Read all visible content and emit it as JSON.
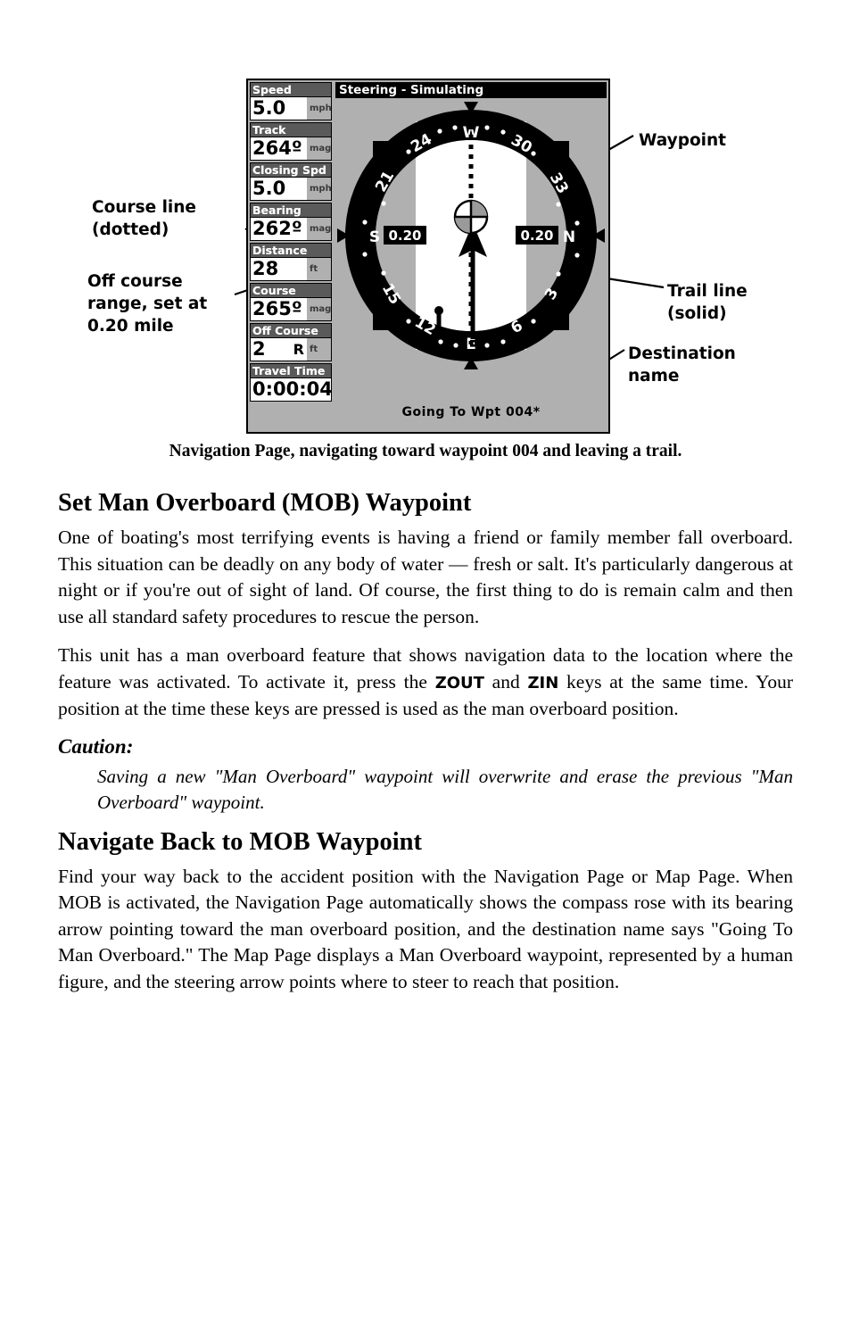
{
  "figure": {
    "panel_title": "Steering - Simulating",
    "destination_name": "Going To Wpt 004*",
    "data_fields": [
      {
        "label": "Speed",
        "value": "5.0",
        "unit": "mph"
      },
      {
        "label": "Track",
        "value": "264º",
        "unit": "mag"
      },
      {
        "label": "Closing Spd",
        "value": "5.0",
        "unit": "mph"
      },
      {
        "label": "Bearing",
        "value": "262º",
        "unit": "mag"
      },
      {
        "label": "Distance",
        "value": "28",
        "unit": "ft"
      },
      {
        "label": "Course",
        "value": "265º",
        "unit": "mag"
      },
      {
        "label": "Off Course",
        "value": "2",
        "side": "R",
        "unit": "ft"
      },
      {
        "label": "Travel Time",
        "value": "0:00:04",
        "unit": ""
      }
    ],
    "compass": {
      "cardinals": [
        "W",
        "N",
        "E",
        "S"
      ],
      "numeric_ticks": [
        "24",
        "21",
        "30",
        "33",
        "15",
        "3",
        "12",
        "6"
      ],
      "range_left": "0.20",
      "range_right": "0.20"
    },
    "callouts": {
      "course_line": "Course line\n(dotted)",
      "off_course": "Off course\nrange, set at\n0.20 mile",
      "waypoint": "Waypoint",
      "trail_line": "Trail line\n(solid)",
      "destination": "Destination\nname"
    },
    "caption": "Navigation Page, navigating toward waypoint 004 and leaving a trail."
  },
  "content": {
    "heading_mob": "Set Man Overboard (MOB) Waypoint",
    "para_1": "One of boating's most terrifying events is having a friend or family member fall overboard. This situation can be deadly on any body of water — fresh or salt. It's particularly dangerous at night or if you're out of sight of land. Of course, the first thing to do is remain calm and then use all standard safety procedures to rescue the person.",
    "para_2_a": "This unit has a man overboard feature that shows navigation data to the location where the feature was activated. To activate it, press the ",
    "key_zout": "ZOUT",
    "para_2_b": " and ",
    "key_zin": "ZIN",
    "para_2_c": " keys at the same time. Your position at the time these keys are pressed is used as the man overboard position.",
    "caution_label": "Caution:",
    "caution_text": "Saving a new \"Man Overboard\" waypoint will overwrite and erase the previous \"Man Overboard\" waypoint.",
    "heading_navigate": "Navigate Back to MOB Waypoint",
    "para_3": "Find your way back to the accident position with the Navigation Page or Map Page. When MOB is activated, the Navigation Page automatically shows the compass rose with its bearing arrow pointing toward the man overboard position, and the destination name says \"Going To Man Overboard.\" The Map Page displays a Man Overboard waypoint, represented by a human figure, and the steering arrow points where to steer to reach that position."
  },
  "colors": {
    "panel_bg": "#b0b0b0",
    "field_label_bg": "#5a5a5a",
    "field_value_bg": "#ffffff",
    "ring": "#000000",
    "corridor": "#ffffff"
  }
}
